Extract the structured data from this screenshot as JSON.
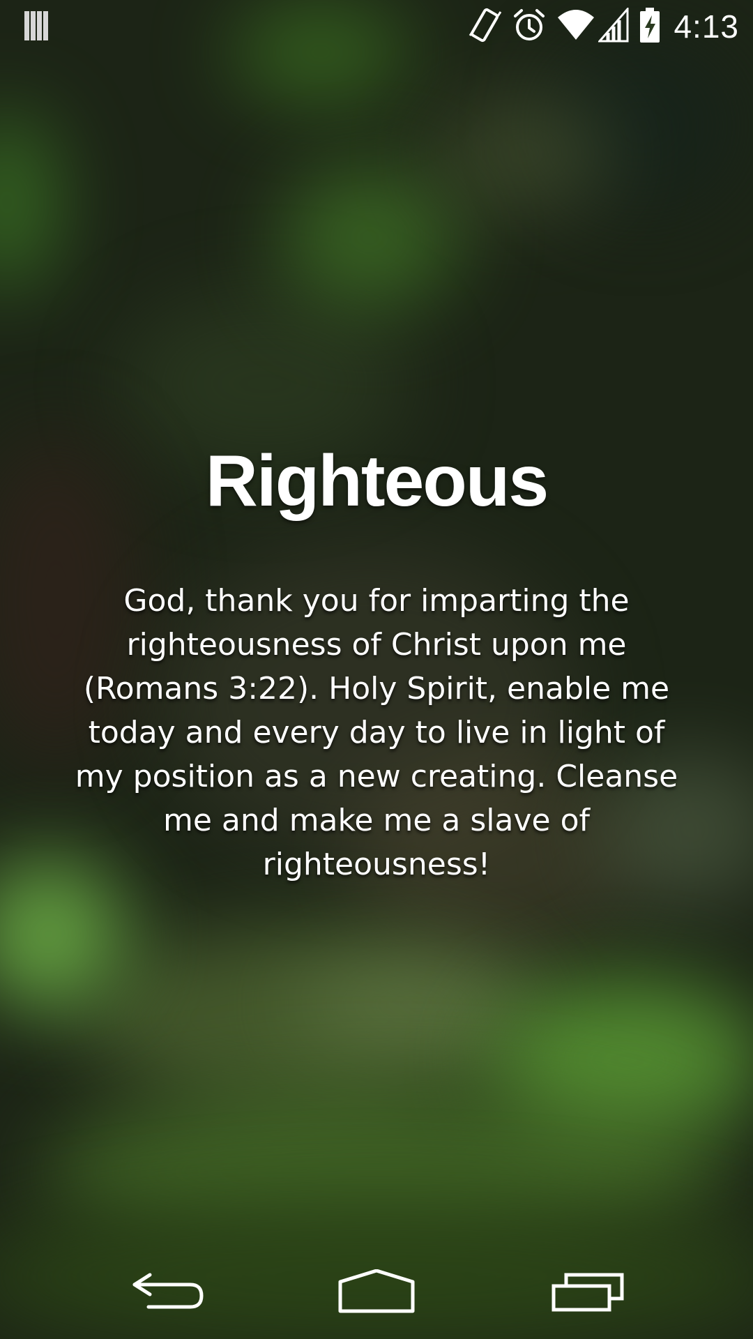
{
  "status_bar": {
    "time": "4:13",
    "icons": [
      "notification-bars-icon",
      "vibrate-icon",
      "alarm-icon",
      "wifi-icon",
      "cell-signal-icon",
      "battery-charging-icon"
    ]
  },
  "card": {
    "title": "Righteous",
    "prayer": "God, thank you for imparting the righteousness of Christ upon me (Romans 3:22). Holy Spirit, enable me today and every day to live in light of my position as a new creating. Cleanse me and make me a slave of righteousness!"
  },
  "nav_bar": {
    "buttons": [
      "back-icon",
      "home-icon",
      "recent-apps-icon"
    ]
  },
  "colors": {
    "text": "#ffffff",
    "wallpaper_dark": "#1c2416",
    "wallpaper_green": "#5a9a34"
  }
}
